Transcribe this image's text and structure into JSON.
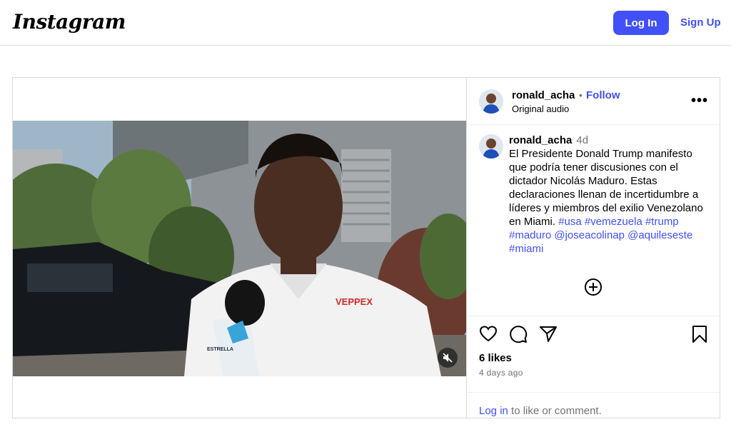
{
  "header": {
    "logo": "Instagram",
    "login_label": "Log In",
    "signup_label": "Sign Up"
  },
  "post": {
    "username": "ronald_acha",
    "separator": "•",
    "follow_label": "Follow",
    "audio": "Original audio",
    "more_label": "•••",
    "caption": {
      "username": "ronald_acha",
      "time": "4d",
      "text": "El Presidente Donald Trump manifesto que podría tener discusiones con el dictador Nicolás Maduro. Estas declaraciones llenan de incertidumbre a líderes y miembros del exilio Venezolano en Miami.",
      "hashtags": [
        "#usa",
        "#vemezuela",
        "#trump",
        "#maduro"
      ],
      "mentions": [
        "@joseacolinap",
        "@aquileseste"
      ],
      "last_tag": "#miami"
    },
    "likes": "6 likes",
    "date": "4 days ago",
    "footer": {
      "login_link": "Log in",
      "rest": " to like or comment."
    },
    "video": {
      "shirt_logo": "VEPPEX",
      "mic_brand": "ESTRELLA"
    }
  },
  "icons": {
    "video_mute": "speaker-muted-icon",
    "add": "plus-circle-icon",
    "like": "heart-icon",
    "comment": "comment-icon",
    "share": "paper-plane-icon",
    "save": "bookmark-icon"
  },
  "colors": {
    "accent": "#4150f7",
    "muted": "#737373",
    "border": "#dbdbdb"
  }
}
